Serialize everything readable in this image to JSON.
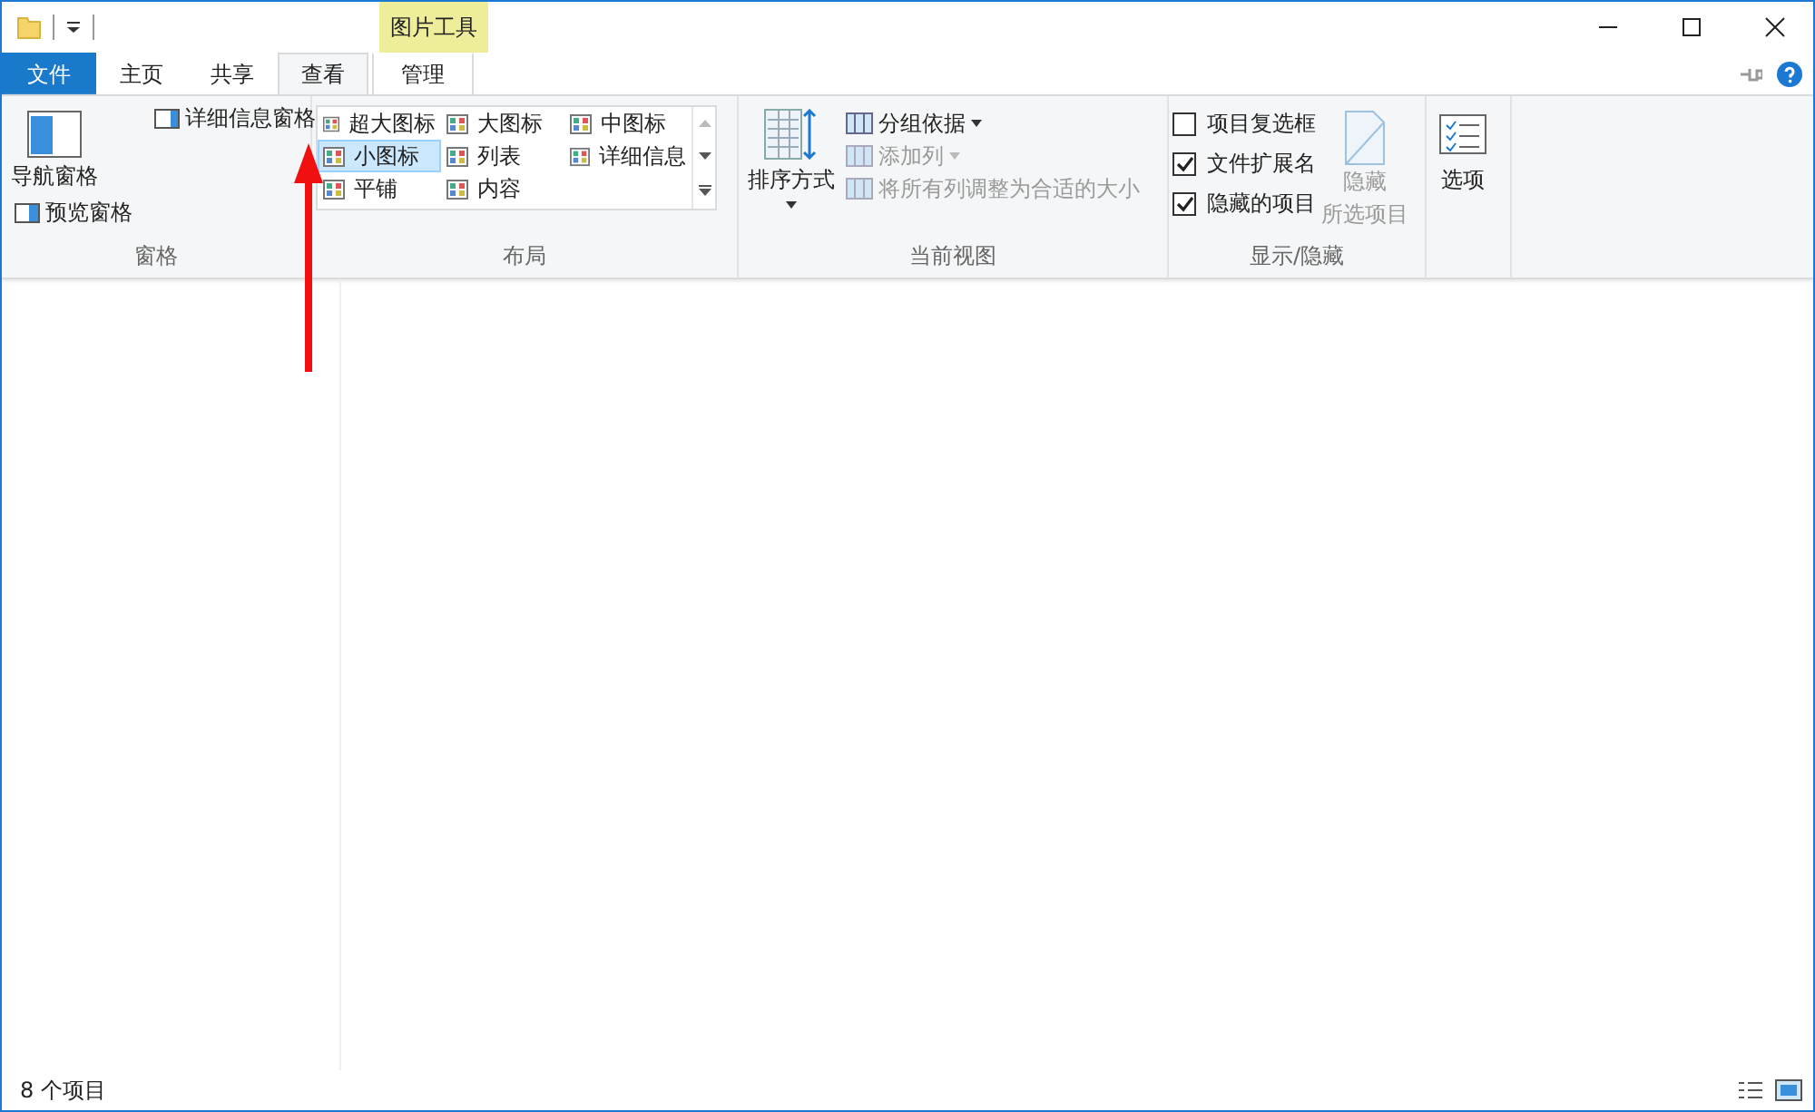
{
  "contextual_tab": {
    "label": "图片工具"
  },
  "tabs": [
    {
      "label": "文件",
      "kind": "file",
      "selected": false
    },
    {
      "label": "主页",
      "kind": "tab",
      "selected": false
    },
    {
      "label": "共享",
      "kind": "tab",
      "selected": false
    },
    {
      "label": "查看",
      "kind": "tab",
      "selected": true
    },
    {
      "label": "管理",
      "kind": "context",
      "selected": false
    }
  ],
  "panes": {
    "title": "窗格",
    "nav_pane": "导航窗格",
    "preview_pane": "预览窗格",
    "details_pane": "详细信息窗格"
  },
  "layout": {
    "title": "布局",
    "options": [
      {
        "label": "超大图标",
        "selected": false
      },
      {
        "label": "大图标",
        "selected": false
      },
      {
        "label": "中图标",
        "selected": false
      },
      {
        "label": "小图标",
        "selected": true
      },
      {
        "label": "列表",
        "selected": false
      },
      {
        "label": "详细信息",
        "selected": false
      },
      {
        "label": "平铺",
        "selected": false
      },
      {
        "label": "内容",
        "selected": false
      }
    ]
  },
  "current_view": {
    "title": "当前视图",
    "sort": "排序方式",
    "commands": [
      {
        "label": "分组依据",
        "disabled": false
      },
      {
        "label": "添加列",
        "disabled": true
      },
      {
        "label": "将所有列调整为合适的大小",
        "disabled": true
      }
    ]
  },
  "show_hide": {
    "title": "显示/隐藏",
    "checkboxes": [
      {
        "label": "项目复选框",
        "checked": false
      },
      {
        "label": "文件扩展名",
        "checked": true
      },
      {
        "label": "隐藏的项目",
        "checked": true
      }
    ],
    "hide_selected": {
      "lines": [
        "隐藏",
        "所选项目"
      ],
      "disabled": true
    }
  },
  "options": {
    "label": "选项"
  },
  "status_bar": {
    "item_count": "8 个项目"
  }
}
